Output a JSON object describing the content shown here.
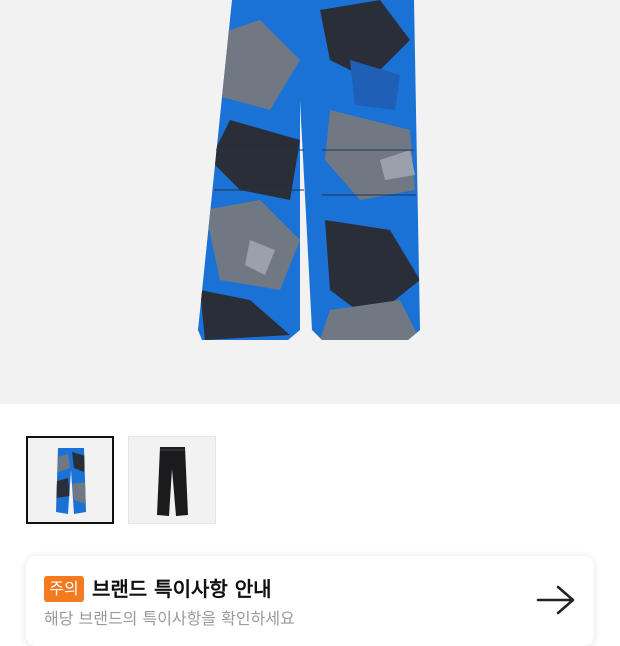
{
  "product_gallery": {
    "main_image": {
      "icon": "camo-cargo-pants-image"
    },
    "thumbnails": [
      {
        "icon": "camo-pants-thumbnail",
        "selected": true
      },
      {
        "icon": "black-pants-thumbnail",
        "selected": false
      }
    ]
  },
  "notice": {
    "badge": "주의",
    "title": "브랜드 특이사항 안내",
    "subtitle": "해당 브랜드의 특이사항을 확인하세요",
    "arrow_icon": "arrow-right-icon"
  },
  "colors": {
    "badge": "#f47a20",
    "camo_blue": "#1a72d6",
    "camo_gray": "#707884",
    "camo_dark": "#2a2e38"
  }
}
